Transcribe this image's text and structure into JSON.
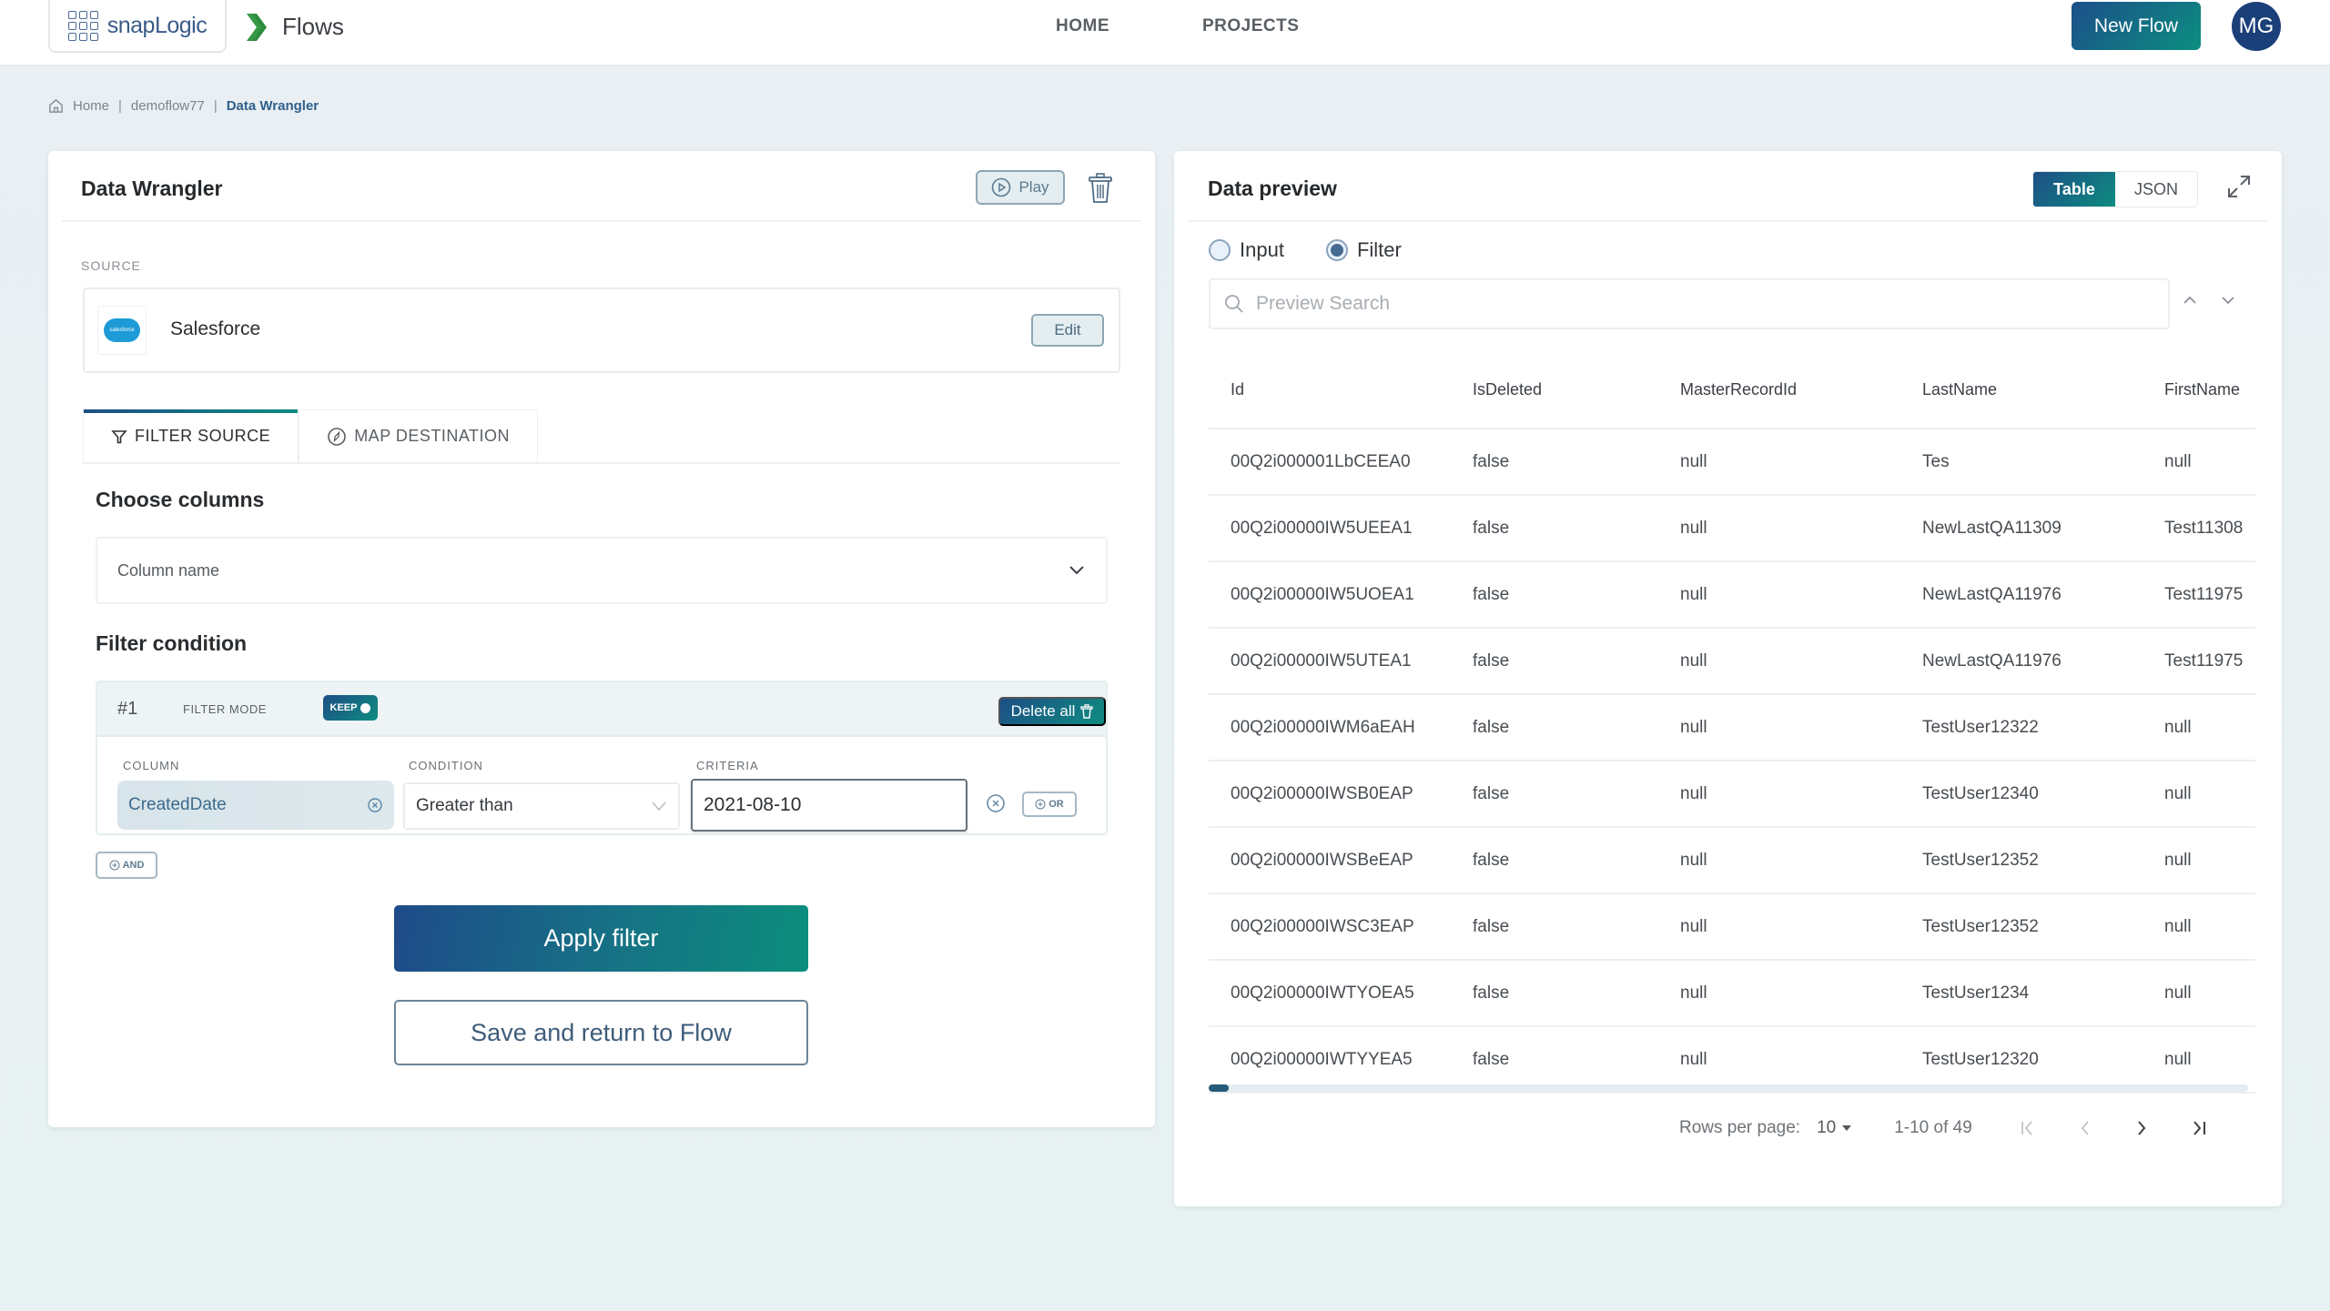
{
  "topbar": {
    "logo_text": "snapLogic",
    "app_name": "Flows",
    "nav": [
      {
        "label": "HOME"
      },
      {
        "label": "PROJECTS"
      }
    ],
    "new_flow_label": "New Flow",
    "avatar_initials": "MG"
  },
  "breadcrumb": {
    "items": [
      "Home",
      "demoflow77",
      "Data Wrangler"
    ]
  },
  "wrangler": {
    "title": "Data Wrangler",
    "play_label": "Play",
    "source_label": "SOURCE",
    "source_name": "Salesforce",
    "source_logo_text": "salesforce",
    "edit_label": "Edit",
    "tabs": [
      {
        "label": "FILTER SOURCE",
        "active": true
      },
      {
        "label": "MAP DESTINATION",
        "active": false
      }
    ],
    "choose_columns_heading": "Choose columns",
    "column_select_placeholder": "Column name",
    "filter_condition_heading": "Filter condition",
    "filter": {
      "number": "#1",
      "mode_label": "FILTER MODE",
      "mode_value": "KEEP",
      "delete_all_label": "Delete all",
      "column_label": "COLUMN",
      "condition_label": "CONDITION",
      "criteria_label": "CRITERIA",
      "column_value": "CreatedDate",
      "condition_value": "Greater than",
      "criteria_value": "2021-08-10",
      "or_label": "OR",
      "and_label": "AND"
    },
    "apply_label": "Apply filter",
    "save_return_label": "Save and return to Flow"
  },
  "preview": {
    "title": "Data preview",
    "view_options": [
      {
        "label": "Table",
        "active": true
      },
      {
        "label": "JSON",
        "active": false
      }
    ],
    "radio": [
      {
        "label": "Input",
        "checked": false
      },
      {
        "label": "Filter",
        "checked": true
      }
    ],
    "search_placeholder": "Preview Search",
    "columns": [
      "Id",
      "IsDeleted",
      "MasterRecordId",
      "LastName",
      "FirstName"
    ],
    "rows": [
      [
        "00Q2i000001LbCEEA0",
        "false",
        "null",
        "Tes",
        "null"
      ],
      [
        "00Q2i00000IW5UEEA1",
        "false",
        "null",
        "NewLastQA11309",
        "Test11308"
      ],
      [
        "00Q2i00000IW5UOEA1",
        "false",
        "null",
        "NewLastQA11976",
        "Test11975"
      ],
      [
        "00Q2i00000IW5UTEA1",
        "false",
        "null",
        "NewLastQA11976",
        "Test11975"
      ],
      [
        "00Q2i00000IWM6aEAH",
        "false",
        "null",
        "TestUser12322",
        "null"
      ],
      [
        "00Q2i00000IWSB0EAP",
        "false",
        "null",
        "TestUser12340",
        "null"
      ],
      [
        "00Q2i00000IWSBeEAP",
        "false",
        "null",
        "TestUser12352",
        "null"
      ],
      [
        "00Q2i00000IWSC3EAP",
        "false",
        "null",
        "TestUser12352",
        "null"
      ],
      [
        "00Q2i00000IWTYOEA5",
        "false",
        "null",
        "TestUser1234",
        "null"
      ],
      [
        "00Q2i00000IWTYYEA5",
        "false",
        "null",
        "TestUser12320",
        "null"
      ]
    ],
    "pagination": {
      "rows_per_page_label": "Rows per page:",
      "rows_per_page_value": "10",
      "range": "1-10 of 49"
    }
  },
  "colors": {
    "brand_gradient_start": "#1d4e86",
    "brand_gradient_end": "#0e8c80",
    "avatar_bg": "#1b3f78",
    "flows_green": "#2e8b3e",
    "salesforce_blue": "#1d9bd7"
  }
}
